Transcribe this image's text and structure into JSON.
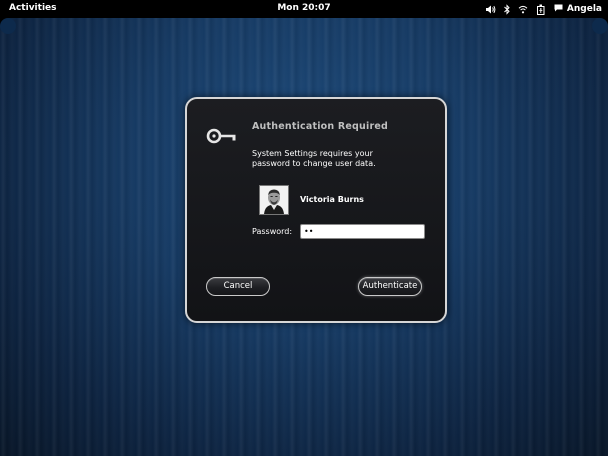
{
  "topbar": {
    "activities_label": "Activities",
    "clock": "Mon 20:07",
    "status_icons": [
      "volume-icon",
      "bluetooth-icon",
      "wifi-icon",
      "accessibility-icon"
    ],
    "user_name": "Angela"
  },
  "dialog": {
    "title": "Authentication Required",
    "message": "System Settings requires your password to change user data.",
    "user_full_name": "Victoria Burns",
    "password_label": "Password:",
    "password_value": "••",
    "cancel_label": "Cancel",
    "authenticate_label": "Authenticate"
  },
  "colors": {
    "background": "#163a63",
    "dialog_bg": "#16171a",
    "dialog_border": "#d6d6d6",
    "title_text": "#bfbfbf"
  }
}
